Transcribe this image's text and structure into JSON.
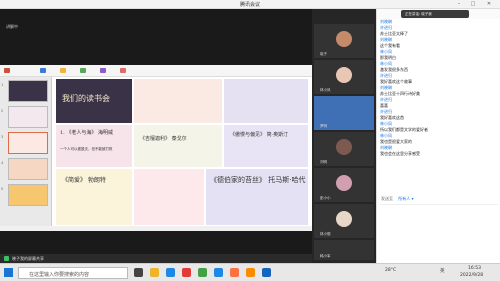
{
  "window": {
    "title": "腾讯会议"
  },
  "mainarea": {
    "net_text": "讲解中"
  },
  "share_bar": {
    "label": "晓子我的屏幕共享"
  },
  "ppt": {
    "slide_numbers": [
      "1",
      "2",
      "3",
      "4",
      "5"
    ],
    "cells": {
      "c1": "我们的读书会",
      "c2": "1. 《老人与海》 海明威",
      "c2b": "一个人可以被毁灭，但不能被打败",
      "c3": "《吉檀迦利》 泰戈尔",
      "c4": "《傲慢与偏见》 简·奥斯汀",
      "c5": "《简爱》 勃朗特",
      "c6": "《德伯家的苔丝》 托马斯·哈代"
    }
  },
  "gallery": {
    "tiles": [
      {
        "name": "晓子"
      },
      {
        "name": "林小凤"
      },
      {
        "name": "罗明"
      },
      {
        "name": "刘明"
      },
      {
        "name": "彭小小"
      },
      {
        "name": "林小丽"
      },
      {
        "name": "韩小军"
      }
    ]
  },
  "chat": {
    "header": "正在讲话: 晓子我",
    "messages": [
      {
        "name": "刘晓琳",
        "text": ""
      },
      {
        "name": "许进归",
        "text": "苏士比亚太棒了"
      },
      {
        "name": "刘晓琳",
        "text": "这个我有看"
      },
      {
        "name": "林小凤",
        "text": "那我明白"
      },
      {
        "name": "林小凤",
        "text": "激发我很多东西"
      },
      {
        "name": "许进归",
        "text": "我好喜欢这个故事"
      },
      {
        "name": "刘晓琳",
        "text": "苏士比亚十四行诗好美"
      },
      {
        "name": "许进归",
        "text": "喜喜"
      },
      {
        "name": "许进归",
        "text": "我好喜欢这首"
      },
      {
        "name": "林小凤",
        "text": "所以我们都是文学的爱好者"
      },
      {
        "name": "林小凤",
        "text": "我也是很爱大家的"
      },
      {
        "name": "刘晓琳",
        "text": "我也会在这里分享感受"
      }
    ],
    "send_to_label": "发送至",
    "send_to_value": "所有人"
  },
  "taskbar": {
    "search_placeholder": "在这里输入你要搜索的内容",
    "weather": "28°C",
    "lang": "英",
    "time": "16:53",
    "date": "2022/9/28"
  }
}
